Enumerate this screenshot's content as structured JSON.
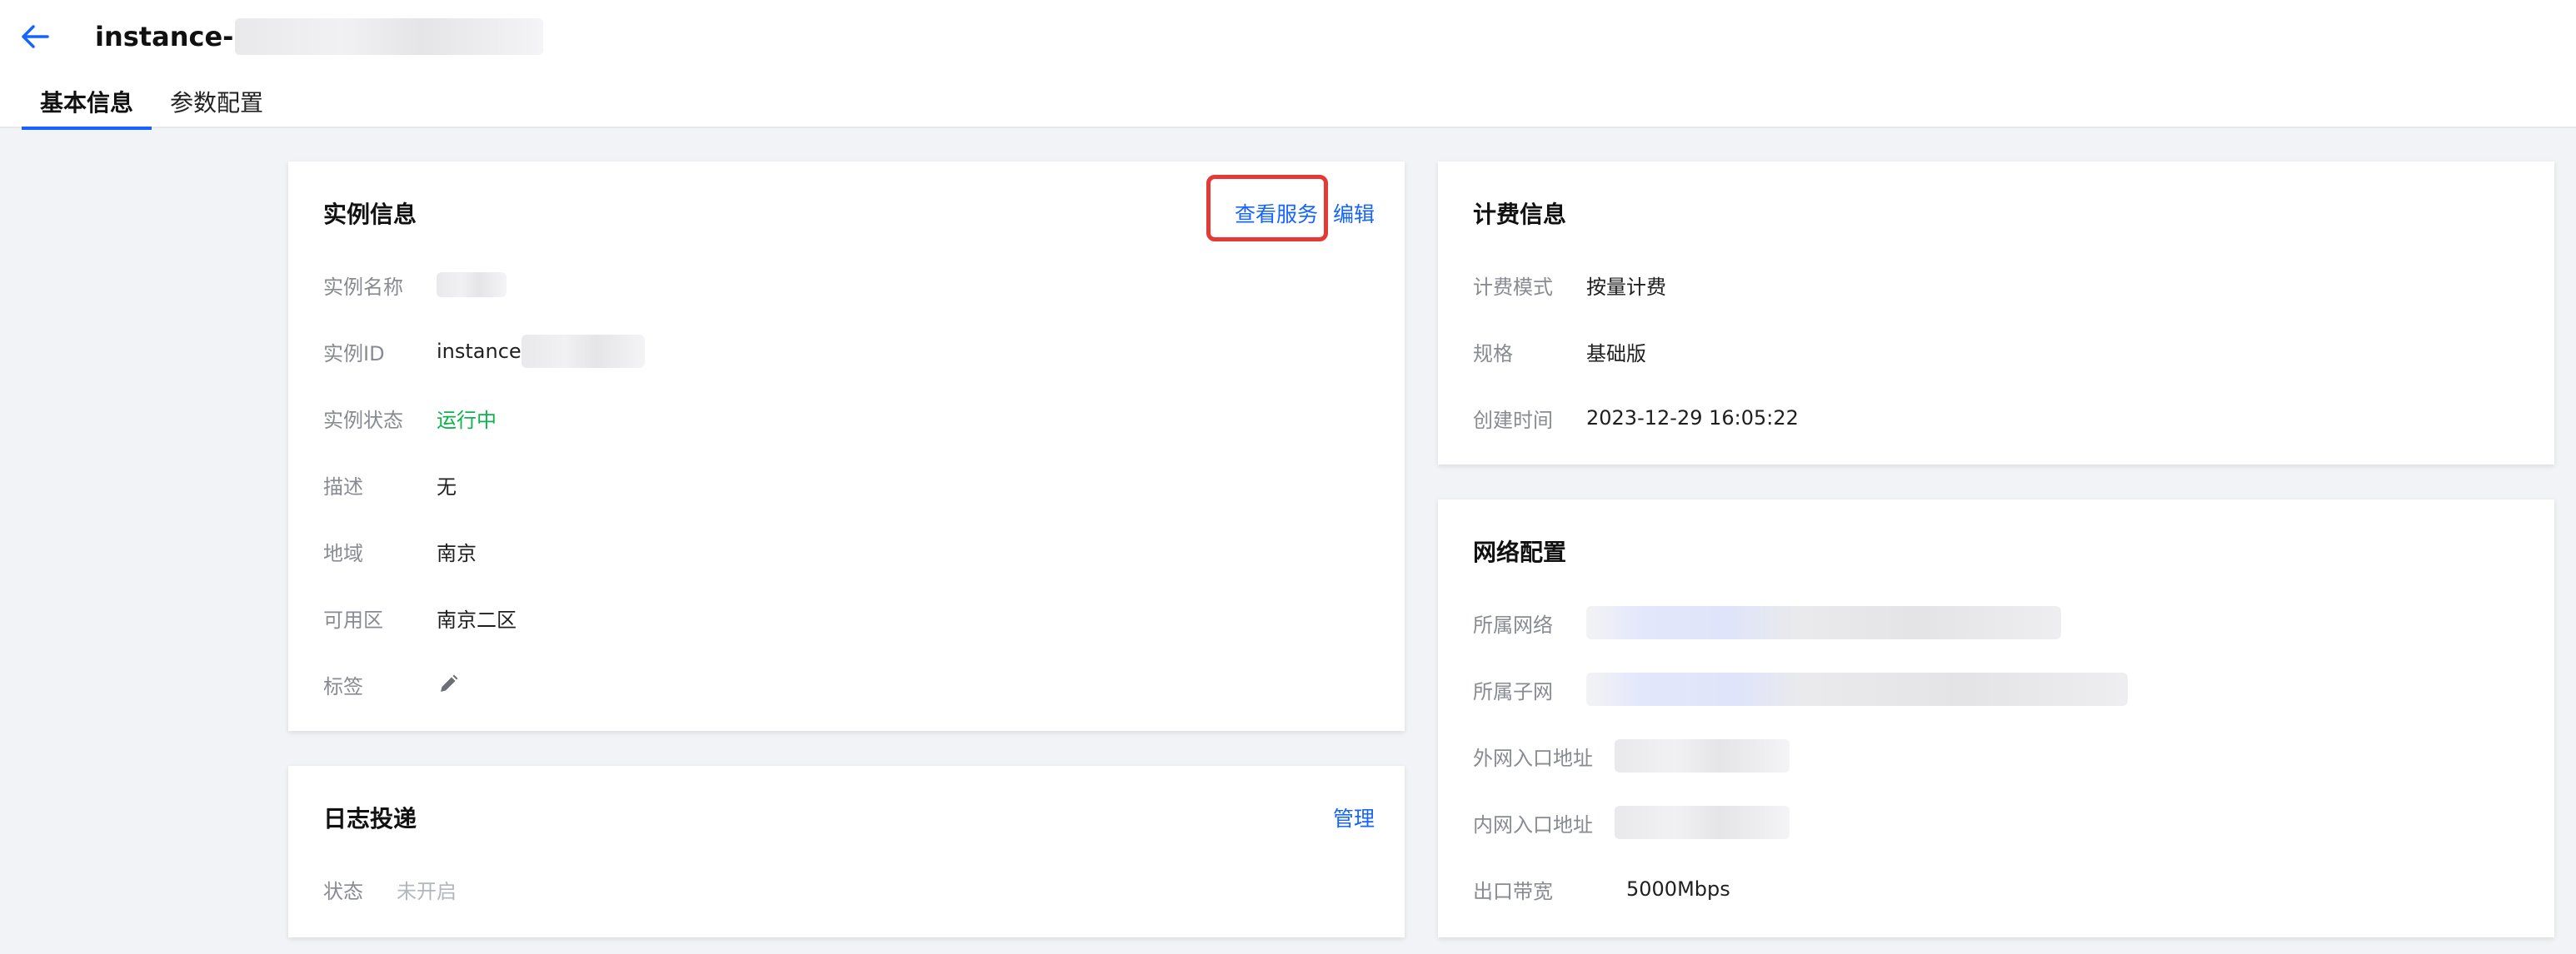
{
  "header": {
    "title_prefix": "instance-",
    "tabs": [
      {
        "label": "基本信息",
        "active": true
      },
      {
        "label": "参数配置",
        "active": false
      }
    ]
  },
  "instance_info": {
    "title": "实例信息",
    "view_service_label": "查看服务",
    "edit_label": "编辑",
    "rows": {
      "name": {
        "label": "实例名称"
      },
      "id": {
        "label": "实例ID",
        "value": "instance"
      },
      "status": {
        "label": "实例状态",
        "value": "运行中"
      },
      "description": {
        "label": "描述",
        "value": "无"
      },
      "region": {
        "label": "地域",
        "value": "南京"
      },
      "zone": {
        "label": "可用区",
        "value": "南京二区"
      },
      "tags": {
        "label": "标签",
        "icon": "pencil-icon"
      }
    }
  },
  "log_delivery": {
    "title": "日志投递",
    "manage_label": "管理",
    "status_label": "状态",
    "status_value": "未开启"
  },
  "billing_info": {
    "title": "计费信息",
    "rows": {
      "mode": {
        "label": "计费模式",
        "value": "按量计费"
      },
      "spec": {
        "label": "规格",
        "value": "基础版"
      },
      "created": {
        "label": "创建时间",
        "value": "2023-12-29 16:05:22"
      }
    }
  },
  "network_config": {
    "title": "网络配置",
    "rows": {
      "vpc": {
        "label": "所属网络"
      },
      "subnet": {
        "label": "所属子网"
      },
      "public_entry": {
        "label": "外网入口地址"
      },
      "private_entry": {
        "label": "内网入口地址"
      },
      "egress_bandwidth": {
        "label": "出口带宽",
        "value": "5000Mbps"
      }
    }
  },
  "colors": {
    "accent": "#1664ff",
    "running": "#0cb34b",
    "highlight_box": "#e53935",
    "background": "#f1f3f7"
  }
}
